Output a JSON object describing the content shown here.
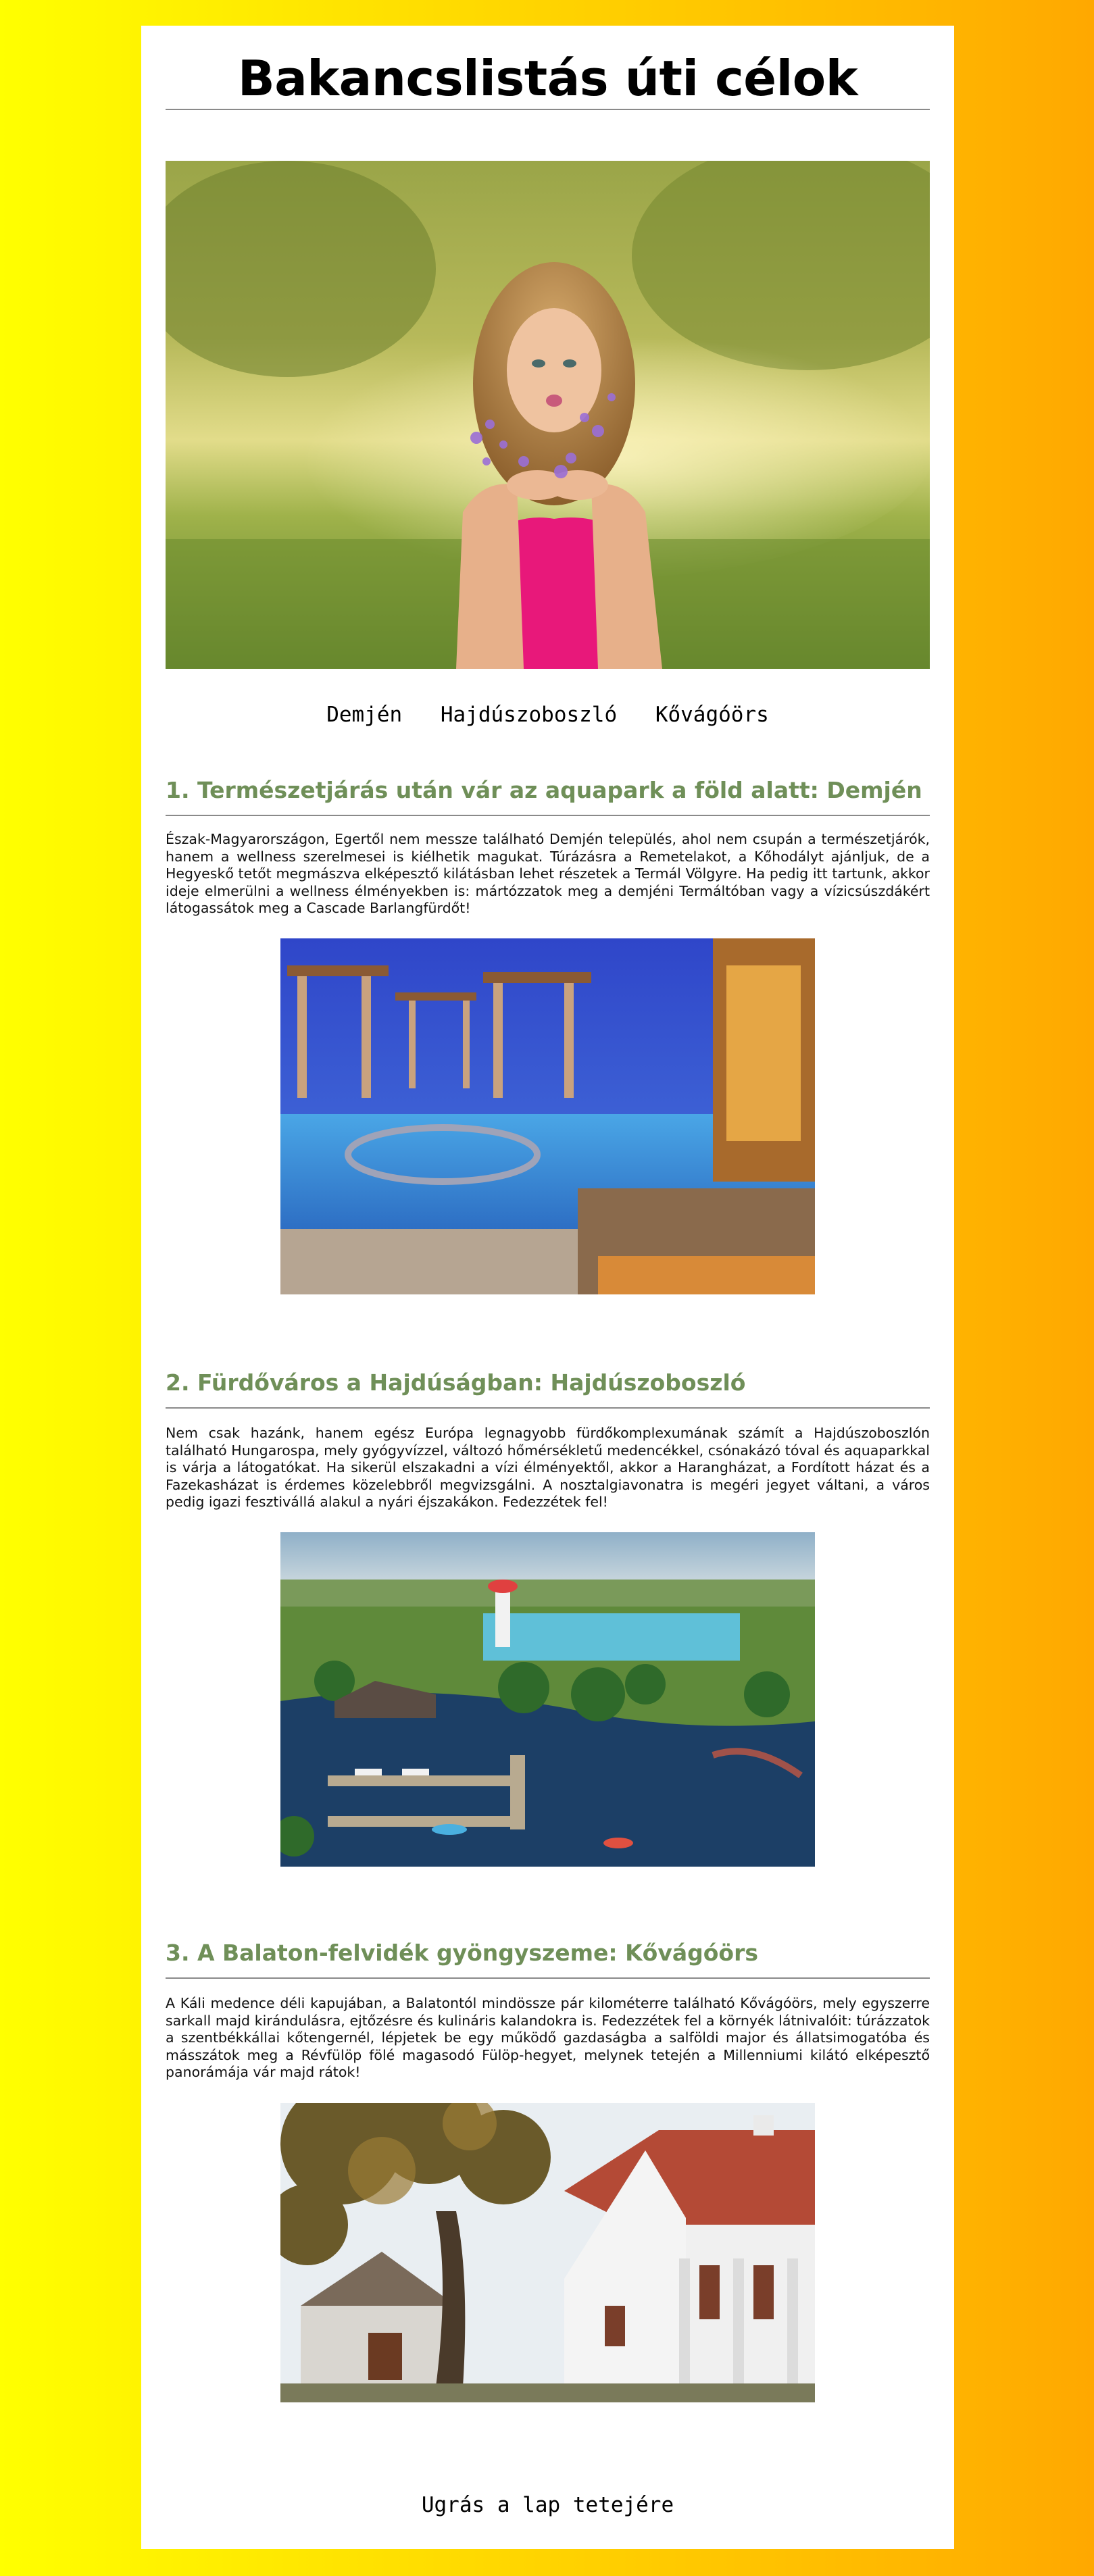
{
  "page": {
    "title": "Bakancslistás úti célok"
  },
  "hero_image": {
    "alt": "hero-photo-woman-blowing-flowers"
  },
  "nav": {
    "items": [
      {
        "label": "Demjén"
      },
      {
        "label": "Hajdúszoboszló"
      },
      {
        "label": "Kővágóörs"
      }
    ]
  },
  "sections": [
    {
      "heading": "1. Természetjárás után vár az aquapark a föld alatt: Demjén",
      "text": "Észak-Magyarországon, Egertől nem messze található Demjén település, ahol nem csupán a természetjárók, hanem a wellness szerelmesei is kiélhetik magukat. Túrázásra a Remetelakot, a Kőhodályt ajánljuk, de a Hegyeskő tetőt megmászva elképesztő kilátásban lehet részetek a Termál Völgyre. Ha pedig itt tartunk, akkor ideje elmerülni a wellness élményekben is: mártózzatok meg a demjéni Termáltóban vagy a vízicsúszdákért látogassátok meg a Cascade Barlangfürdőt!"
    },
    {
      "heading": "2. Fürdőváros a Hajdúságban: Hajdúszoboszló",
      "text": "Nem csak hazánk, hanem egész Európa legnagyobb fürdőkomplexumának számít a Hajdúszoboszlón található Hungarospa, mely gyógyvízzel, változó hőmérsékletű medencékkel, csónakázó tóval és aquaparkkal is várja a látogatókat. Ha sikerül elszakadni a vízi élményektől, akkor a Harangházat, a Fordított házat és a Fazekasházat is érdemes közelebbről megvizsgálni. A nosztalgiavonatra is megéri jegyet váltani, a város pedig igazi fesztivállá alakul a nyári éjszakákon. Fedezzétek fel!"
    },
    {
      "heading": "3. A Balaton-felvidék gyöngyszeme: Kővágóörs",
      "text": "A Káli medence déli kapujában, a Balatontól mindössze pár kilométerre található Kővágóörs, mely egyszerre sarkall majd kirándulásra, ejtőzésre és kulináris kalandokra is. Fedezzétek fel a környék látnivalóit: túrázzatok a szentbékkállai kőtengernél, lépjetek be egy működő gazdaságba a salföldi major és állatsimogatóba és másszátok meg a Révfülöp fölé magasodó Fülöp-hegyet, melynek tetején a Millenniumi kilátó elképesztő panorámája vár majd rátok!"
    }
  ],
  "footer": {
    "top_link": "Ugrás a lap tetejére"
  }
}
